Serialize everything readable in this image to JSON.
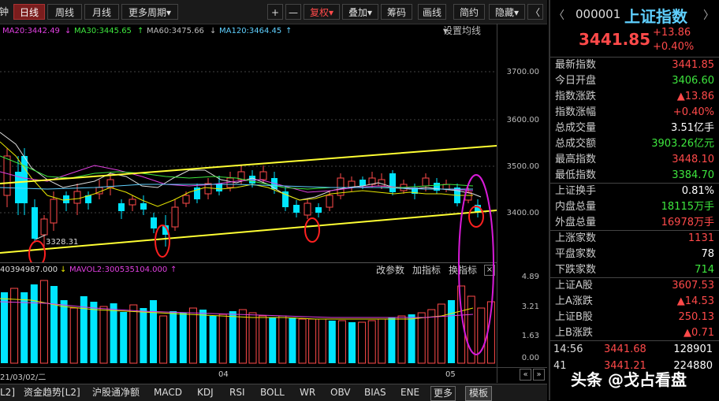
{
  "toolbar": {
    "tabs": [
      "钟",
      "日线",
      "周线",
      "月线",
      "更多周期"
    ],
    "buttons": [
      "+",
      "—",
      "复权",
      "叠加",
      "筹码",
      "画线",
      "简约",
      "隐藏"
    ],
    "dropdown_glyph": "▾",
    "back_glyph": "〈"
  },
  "ma_legend": {
    "ma20": "MA20:3442.49",
    "ma30": "MA30:3445.65",
    "ma60": "MA60:3475.66",
    "ma120": "MA120:3464.45",
    "settings": "设置均线"
  },
  "price_axis": [
    "3700.00",
    "3600.00",
    "3500.00",
    "3400.00"
  ],
  "low_annotation": "3328.31",
  "volume_header": {
    "mavol1": "40394987.000",
    "mavol2": "MAVOL2:300535104.000",
    "buttons": [
      "改参数",
      "加指标",
      "换指标"
    ],
    "close_glyph": "×"
  },
  "volume_axis": [
    "4.89",
    "3.21",
    "1.63",
    "0.00"
  ],
  "x_axis": {
    "start": "21/03/02/二",
    "m4": "04",
    "m5": "05"
  },
  "bottom_tabs": [
    "L2]",
    "资金趋势[L2]",
    "沪股通净额",
    "MACD",
    "KDJ",
    "RSI",
    "BOLL",
    "WR",
    "OBV",
    "BIAS",
    "ENE",
    "更多",
    "模板"
  ],
  "quote": {
    "code": "000001",
    "name": "上证指数",
    "price": "3441.85",
    "change": "+13.86",
    "change_pct": "+0.40%",
    "rows": [
      {
        "label": "最新指数",
        "value": "3441.85",
        "color": "red"
      },
      {
        "label": "今日开盘",
        "value": "3406.60",
        "color": "green"
      },
      {
        "label": "指数涨跌",
        "value": "▲13.86",
        "color": "red"
      },
      {
        "label": "指数涨幅",
        "value": "+0.40%",
        "color": "red"
      },
      {
        "label": "总成交量",
        "value": "3.51亿手",
        "color": "white"
      },
      {
        "label": "总成交额",
        "value": "3903.26亿元",
        "color": "green"
      },
      {
        "label": "最高指数",
        "value": "3448.10",
        "color": "red"
      },
      {
        "label": "最低指数",
        "value": "3384.70",
        "color": "green"
      },
      {
        "label": "上证换手",
        "value": "0.81%",
        "color": "white"
      },
      {
        "label": "内盘总量",
        "value": "18115万手",
        "color": "green"
      },
      {
        "label": "外盘总量",
        "value": "16978万手",
        "color": "red"
      },
      {
        "label": "上涨家数",
        "value": "1131",
        "color": "red"
      },
      {
        "label": "平盘家数",
        "value": "78",
        "color": "white"
      },
      {
        "label": "下跌家数",
        "value": "714",
        "color": "green"
      },
      {
        "label": "上证A股",
        "value": "3607.53",
        "color": "red"
      },
      {
        "label": "上A涨跌",
        "value": "▲14.53",
        "color": "red"
      },
      {
        "label": "上证B股",
        "value": "250.13",
        "color": "red"
      },
      {
        "label": "上B涨跌",
        "value": "▲0.71",
        "color": "red"
      }
    ],
    "ticks": [
      {
        "time": "14:56",
        "price": "3441.68",
        "vol": "128901"
      },
      {
        "time": "41",
        "price": "3441.21",
        "vol": "224880"
      },
      {
        "time": "",
        "price": "",
        "vol": ""
      }
    ]
  },
  "watermark": "头条 @戈占看盘"
}
